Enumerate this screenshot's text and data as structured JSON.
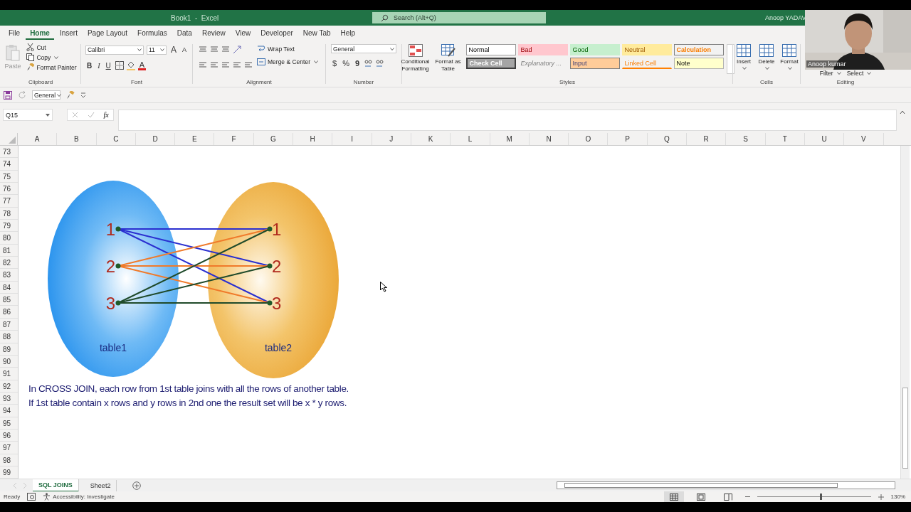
{
  "window": {
    "title": "Book1  -  Excel",
    "search_placeholder": "Search (Alt+Q)",
    "user": "Anoop YADAV"
  },
  "menu_tabs": [
    {
      "label": "File",
      "selected": false
    },
    {
      "label": "Home",
      "selected": true
    },
    {
      "label": "Insert",
      "selected": false
    },
    {
      "label": "Page Layout",
      "selected": false
    },
    {
      "label": "Formulas",
      "selected": false
    },
    {
      "label": "Data",
      "selected": false
    },
    {
      "label": "Review",
      "selected": false
    },
    {
      "label": "View",
      "selected": false
    },
    {
      "label": "Developer",
      "selected": false
    },
    {
      "label": "New Tab",
      "selected": false
    },
    {
      "label": "Help",
      "selected": false
    }
  ],
  "ribbon": {
    "clipboard": {
      "paste": "Paste",
      "cut": "Cut",
      "copy": "Copy",
      "format_painter": "Format Painter",
      "label": "Clipboard"
    },
    "font": {
      "name": "Calibri",
      "size": "11",
      "grow": "A",
      "shrink": "A",
      "bold": "B",
      "italic": "I",
      "underline": "U",
      "font_color": "A",
      "label": "Font"
    },
    "alignment": {
      "wrap": "Wrap Text",
      "merge": "Merge & Center",
      "label": "Alignment"
    },
    "number": {
      "format": "General",
      "currency": "$",
      "percent": "%",
      "comma": "9",
      "label": "Number"
    },
    "styles": {
      "conditional": "Conditional Formatting",
      "format_table": "Format as Table",
      "label": "Styles",
      "cell_styles": [
        {
          "label": "Normal",
          "kind": "normal"
        },
        {
          "label": "Bad",
          "kind": "bad"
        },
        {
          "label": "Good",
          "kind": "good"
        },
        {
          "label": "Neutral",
          "kind": "neutral"
        },
        {
          "label": "Calculation",
          "kind": "calculation"
        },
        {
          "label": "Check Cell",
          "kind": "check"
        },
        {
          "label": "Explanatory ...",
          "kind": "explanatory"
        },
        {
          "label": "Input",
          "kind": "input"
        },
        {
          "label": "Linked Cell",
          "kind": "linked"
        },
        {
          "label": "Note",
          "kind": "note"
        }
      ]
    },
    "cells": {
      "buttons": [
        "Insert",
        "Delete",
        "Format"
      ],
      "label": "Cells"
    },
    "editing": {
      "buttons": [
        "Filter",
        "Select"
      ],
      "label": "Editing"
    }
  },
  "quick_access": {
    "number_format": "General"
  },
  "formula_bar": {
    "name_box": "Q15",
    "fx": "fx"
  },
  "columns": [
    "A",
    "B",
    "C",
    "D",
    "E",
    "F",
    "G",
    "H",
    "I",
    "J",
    "K",
    "L",
    "M",
    "N",
    "O",
    "P",
    "Q",
    "R",
    "S",
    "T",
    "U",
    "V"
  ],
  "rows": [
    "73",
    "74",
    "75",
    "76",
    "77",
    "78",
    "79",
    "80",
    "81",
    "82",
    "83",
    "84",
    "85",
    "86",
    "87",
    "88",
    "89",
    "90",
    "91",
    "92",
    "93",
    "94",
    "95",
    "96",
    "97",
    "98",
    "99"
  ],
  "diagram": {
    "left_label": "table1",
    "right_label": "table2",
    "left_nodes": [
      {
        "label": "1",
        "color": "#2a2fd0"
      },
      {
        "label": "2",
        "color": "#f07a2a"
      },
      {
        "label": "3",
        "color": "#1f4a2a"
      }
    ],
    "right_nodes": [
      {
        "label": "1"
      },
      {
        "label": "2"
      },
      {
        "label": "3"
      }
    ]
  },
  "notes": [
    "In CROSS JOIN, each row from 1st table joins with all the rows of another table.",
    "If 1st table contain x rows and y rows in 2nd one the result set will be x * y rows."
  ],
  "sheet_tabs": [
    {
      "label": "SQL JOINS",
      "selected": true
    },
    {
      "label": "Sheet2",
      "selected": false
    }
  ],
  "status_bar": {
    "ready": "Ready",
    "accessibility": "Accessibility: Investigate",
    "zoom": "130%",
    "zoom_slider": {
      "level": 0.56
    },
    "views": [
      {
        "kind": "normal",
        "selected": true
      },
      {
        "kind": "layout",
        "selected": false
      },
      {
        "kind": "break",
        "selected": false
      }
    ]
  },
  "webcam": {
    "name": "Anoop kumar"
  }
}
